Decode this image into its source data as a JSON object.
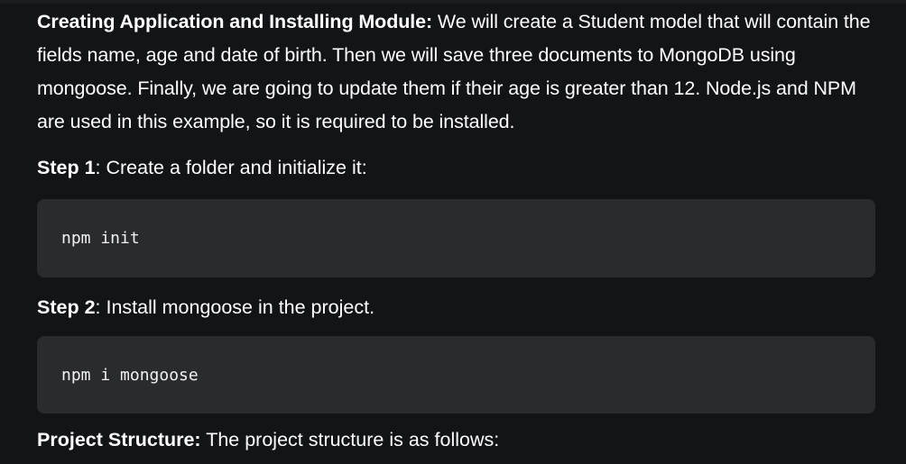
{
  "intro": {
    "bold": "Creating Application and Installing Module:",
    "text": " We will create a Student model that will contain the fields name, age and date of birth. Then we will save three documents to MongoDB using mongoose. Finally, we are going to update them if their age is greater than 12. Node.js and NPM are used in this example, so it is required to be installed."
  },
  "step1": {
    "bold": "Step 1",
    "text": ": Create a folder and initialize it:",
    "code": "npm init"
  },
  "step2": {
    "bold": "Step 2",
    "text": ": Install mongoose in the project.",
    "code": "npm i mongoose"
  },
  "structure": {
    "bold": "Project Structure:",
    "text": " The project structure is as follows:"
  },
  "colors": {
    "background": "#131417",
    "code_background": "#2a2b2f",
    "text": "#ffffff"
  }
}
